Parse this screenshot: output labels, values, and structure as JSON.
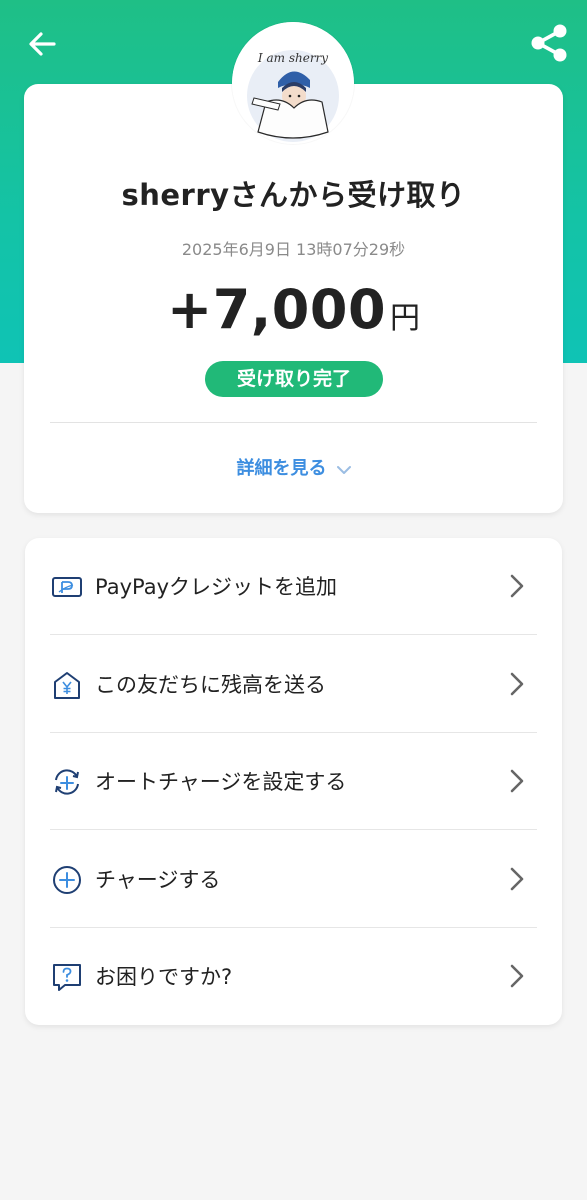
{
  "header": {
    "back_icon": "arrow-left-icon",
    "share_icon": "share-icon"
  },
  "profile": {
    "avatar_text": "I am sherry"
  },
  "receipt": {
    "title": "sherryさんから受け取り",
    "datetime": "2025年6月9日 13時07分29秒",
    "amount": "+7,000",
    "currency": "円",
    "status": "受け取り完了",
    "detail_link": "詳細を見る"
  },
  "menu": {
    "items": [
      {
        "label": "PayPayクレジットを追加",
        "icon": "credit-card-icon"
      },
      {
        "label": "この友だちに残高を送る",
        "icon": "send-yen-icon"
      },
      {
        "label": "オートチャージを設定する",
        "icon": "auto-charge-icon"
      },
      {
        "label": "チャージする",
        "icon": "charge-plus-icon"
      },
      {
        "label": "お困りですか?",
        "icon": "help-icon"
      }
    ]
  },
  "colors": {
    "header_green": "#1fbf86",
    "status_green": "#21b978",
    "link_blue": "#3d8ee0",
    "icon_navy": "#1f3f73"
  }
}
